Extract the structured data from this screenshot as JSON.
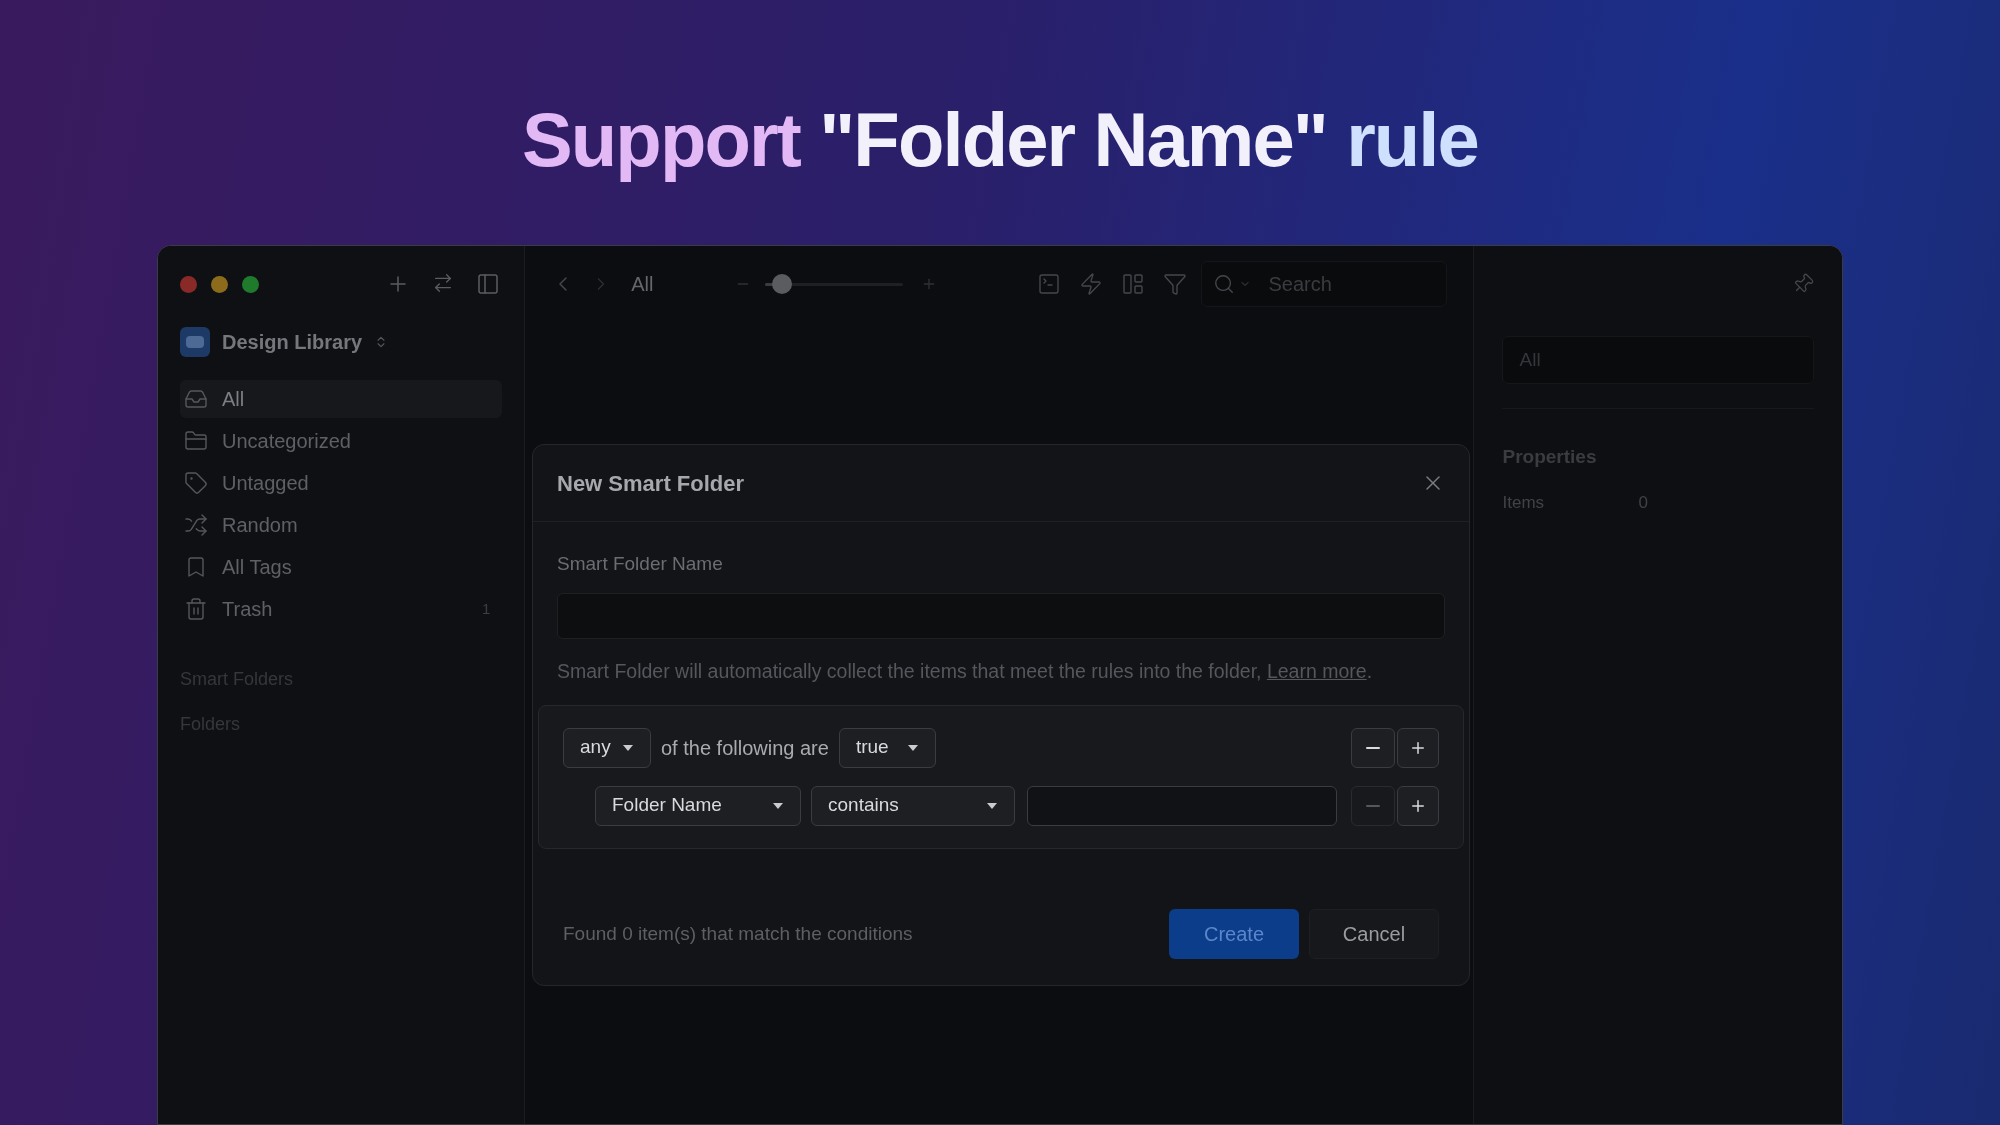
{
  "headline": {
    "before": "Support ",
    "quoted": "\"Folder Name\"",
    "after": " rule"
  },
  "sidebar": {
    "library": "Design Library",
    "items": [
      {
        "label": "All",
        "kind": "inbox",
        "selected": true
      },
      {
        "label": "Uncategorized",
        "kind": "folder",
        "selected": false
      },
      {
        "label": "Untagged",
        "kind": "tag",
        "selected": false
      },
      {
        "label": "Random",
        "kind": "shuffle",
        "selected": false
      },
      {
        "label": "All Tags",
        "kind": "bookmark",
        "selected": false
      },
      {
        "label": "Trash",
        "kind": "trash",
        "selected": false,
        "count": "1"
      }
    ],
    "sections": [
      "Smart Folders",
      "Folders"
    ]
  },
  "toolbar": {
    "location": "All",
    "zoom": {
      "level": 0.12
    },
    "search": {
      "placeholder": "Search"
    }
  },
  "inspector": {
    "name_field": {
      "placeholder": "All"
    },
    "heading": "Properties",
    "rows": [
      {
        "label": "Items",
        "value": "0"
      }
    ]
  },
  "dialog": {
    "title": "New Smart Folder",
    "name_label": "Smart Folder Name",
    "description": "Smart Folder will automatically collect the items that meet the rules into the folder,",
    "link": "Learn more",
    "period": ".",
    "match": {
      "quantifier": "any",
      "connector": "of the following are",
      "truth": "true",
      "remove_disabled": false
    },
    "rules": [
      {
        "field": "Folder Name",
        "operator": "contains",
        "remove_disabled": true
      }
    ],
    "status": "Found 0 item(s) that match the conditions",
    "buttons": [
      {
        "label": "Create",
        "kind": "primary"
      },
      {
        "label": "Cancel",
        "kind": "secondary"
      }
    ]
  }
}
